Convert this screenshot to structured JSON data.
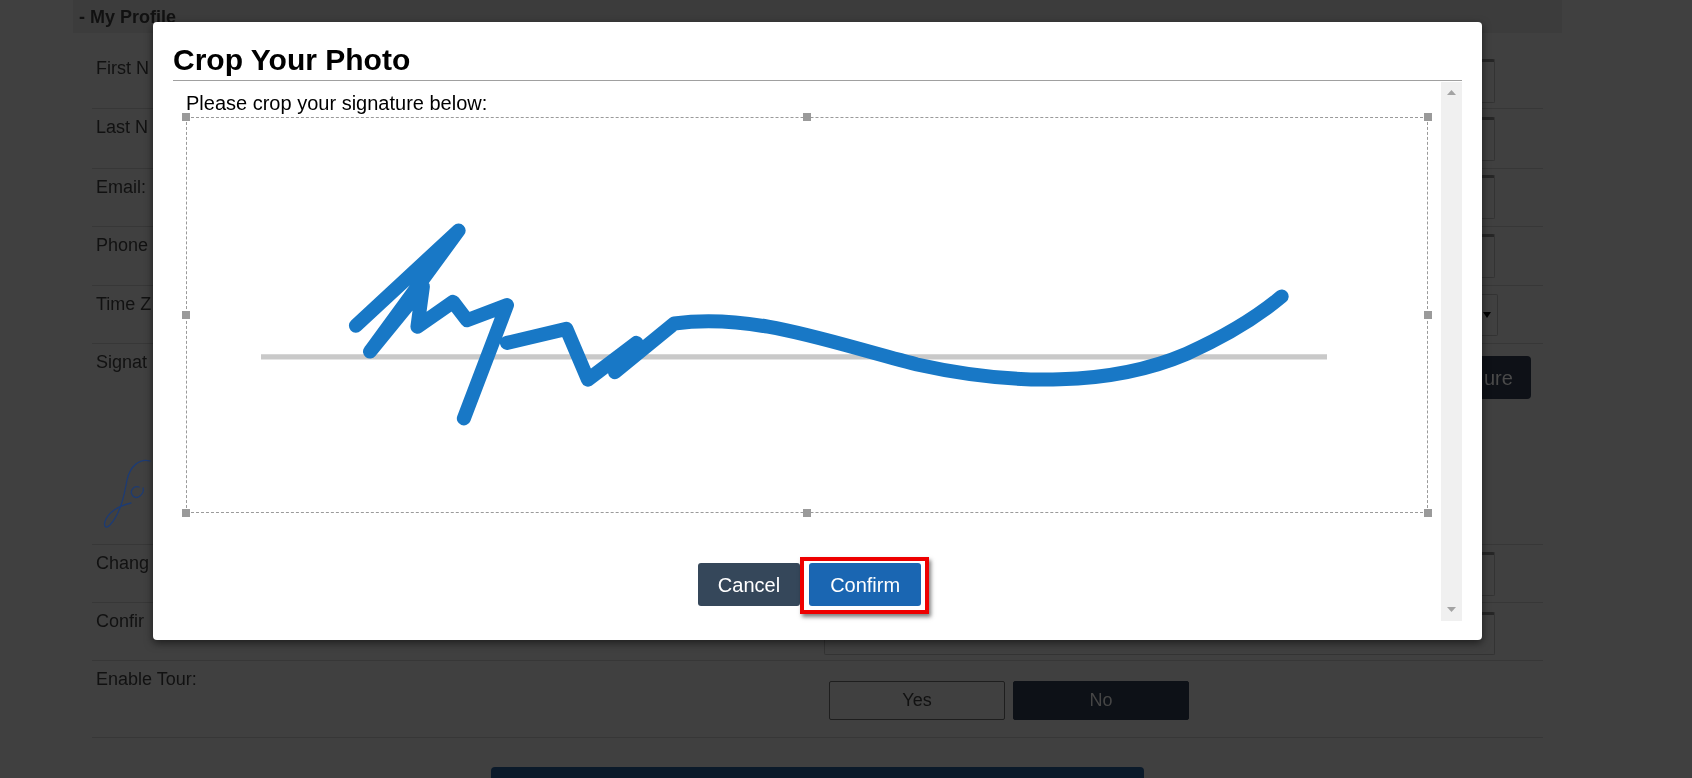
{
  "profile": {
    "title": "- My Profile",
    "rows": [
      {
        "label": "First N",
        "kind": "input"
      },
      {
        "label": "Last N",
        "kind": "input"
      },
      {
        "label": "Email:",
        "kind": "input"
      },
      {
        "label": "Phone",
        "kind": "input"
      },
      {
        "label": "Time Z",
        "kind": "select"
      },
      {
        "label": "Signat",
        "kind": "signature",
        "button": "ure"
      },
      {
        "label": "Chang",
        "kind": "input"
      },
      {
        "label": "Confir",
        "kind": "input"
      },
      {
        "label": "Enable Tour:",
        "kind": "toggle",
        "options": [
          {
            "label": "Yes",
            "selected": false
          },
          {
            "label": "No",
            "selected": true
          }
        ]
      }
    ]
  },
  "dialog": {
    "title": "Crop Your Photo",
    "instruction": "Please crop your signature below:",
    "buttons": [
      {
        "label": "Cancel",
        "kind": "secondary",
        "highlighted": false
      },
      {
        "label": "Confirm",
        "kind": "primary",
        "highlighted": true
      }
    ]
  }
}
